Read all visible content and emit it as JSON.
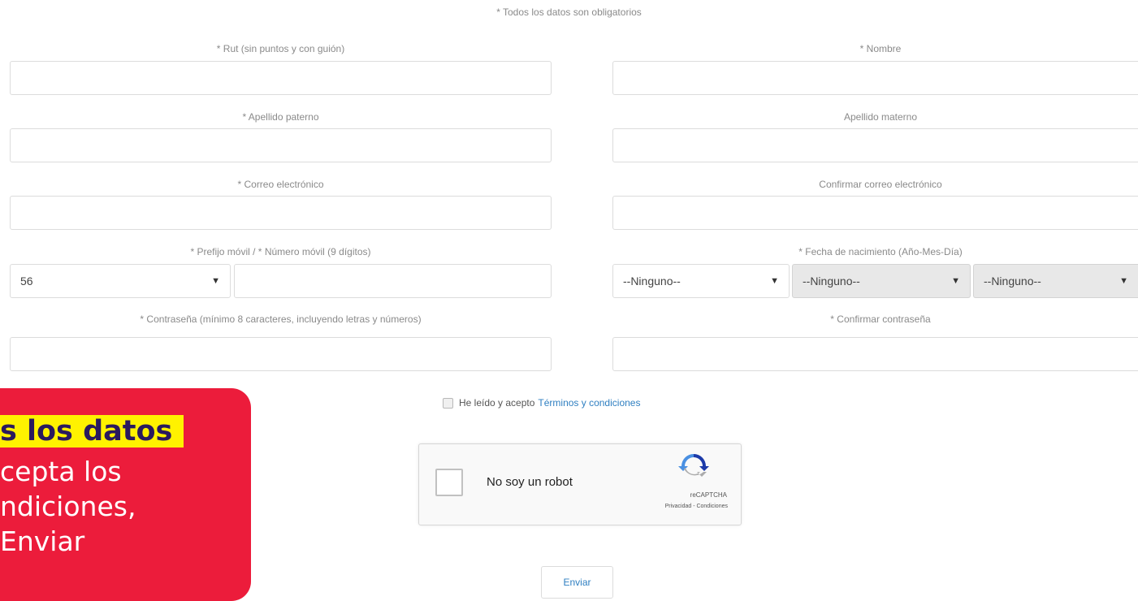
{
  "form": {
    "notice": "* Todos los datos son obligatorios",
    "rut_label": "* Rut (sin puntos y con guión)",
    "nombre_label": "* Nombre",
    "apellido_paterno_label": "* Apellido paterno",
    "apellido_materno_label": "Apellido materno",
    "correo_label": "* Correo electrónico",
    "confirmar_correo_label": "Confirmar correo electrónico",
    "movil_label": "* Prefijo móvil / * Número móvil (9 dígitos)",
    "prefijo_value": "56",
    "fecha_label": "* Fecha de nacimiento (Año-Mes-Día)",
    "fecha_year_value": "--Ninguno--",
    "fecha_month_value": "--Ninguno--",
    "fecha_day_value": "--Ninguno--",
    "contrasena_label": "* Contraseña (mínimo 8 caracteres, incluyendo letras y números)",
    "confirmar_contrasena_label": "* Confirmar contraseña",
    "terms_text": "He leído y acepto",
    "terms_link": "Términos y condiciones",
    "submit_label": "Enviar"
  },
  "captcha": {
    "label": "No soy un robot",
    "brand": "reCAPTCHA",
    "privacy": "Privacidad - Condiciones"
  },
  "overlay": {
    "line1": "s los datos",
    "line2": "cepta los",
    "line3": "ndiciones,",
    "line4": "Enviar"
  },
  "colors": {
    "overlay_bg": "#ec1c3b",
    "highlight": "#fff200",
    "link": "#2f7fc1"
  },
  "icons": {
    "select_arrow": "triangle-down",
    "captcha_logo": "recaptcha-logo"
  }
}
